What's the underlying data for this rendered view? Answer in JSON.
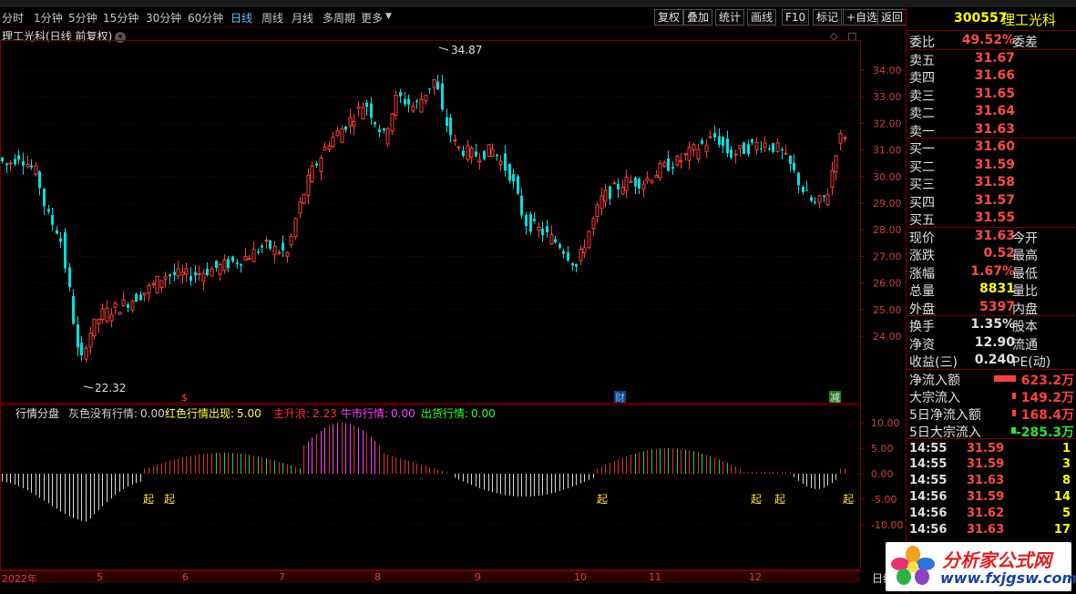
{
  "toolbar": {
    "periods": [
      "分时",
      "1分钟",
      "5分钟",
      "15分钟",
      "30分钟",
      "60分钟",
      "日线",
      "周线",
      "月线",
      "多周期",
      "更多"
    ],
    "active_period": "日线",
    "right_buttons": [
      "复权",
      "叠加",
      "统计",
      "画线",
      "F10",
      "标记",
      "+自选",
      "返回"
    ]
  },
  "chart": {
    "title": "理工光科(日线 前复权)",
    "title_icon": "chevron-down-icon",
    "controls": [
      "◇",
      "□"
    ],
    "price_axis": [
      "34.00",
      "33.00",
      "32.00",
      "31.00",
      "30.00",
      "29.00",
      "28.00",
      "27.00",
      "26.00",
      "25.00",
      "24.00"
    ],
    "high_label": "34.87",
    "low_label": "22.32",
    "markers": [
      "$",
      "财",
      "减"
    ],
    "colors": {
      "up": "#ff3c3c",
      "down": "#00e0e0",
      "grid": "#5a0000"
    }
  },
  "indicator": {
    "name": "行情分盘",
    "items": [
      {
        "label": "灰色没有行情:",
        "value": "0.00",
        "color": "#d0d0d0"
      },
      {
        "label": "红色行情出现:",
        "value": "5.00",
        "color": "#ffff40"
      },
      {
        "label": "主升浪:",
        "value": "2.23",
        "color": "#ff3030"
      },
      {
        "label": "牛市行情:",
        "value": "0.00",
        "color": "#ff40ff"
      },
      {
        "label": "出货行情:",
        "value": "0.00",
        "color": "#30ff30"
      }
    ],
    "axis": [
      "10.00",
      "5.00",
      "0.00",
      "-5.00",
      "-10.00"
    ],
    "signal_text": "起",
    "colors": {
      "gray": "#d8d8d8",
      "red": "#e03030",
      "green": "#30d030",
      "magenta": "#ff40ff"
    }
  },
  "date_axis": [
    "2022年",
    "5",
    "6",
    "7",
    "8",
    "9",
    "10",
    "11",
    "12"
  ],
  "date_axis_right": "日线",
  "quote": {
    "code": "300557",
    "name": "理工光科",
    "wei_bi_label": "委比",
    "wei_bi": "49.52%",
    "wei_cha_label": "委差",
    "asks": [
      {
        "label": "卖五",
        "price": "31.67"
      },
      {
        "label": "卖四",
        "price": "31.66"
      },
      {
        "label": "卖三",
        "price": "31.65"
      },
      {
        "label": "卖二",
        "price": "31.64"
      },
      {
        "label": "卖一",
        "price": "31.63"
      }
    ],
    "bids": [
      {
        "label": "买一",
        "price": "31.60"
      },
      {
        "label": "买二",
        "price": "31.59"
      },
      {
        "label": "买三",
        "price": "31.58"
      },
      {
        "label": "买四",
        "price": "31.57"
      },
      {
        "label": "买五",
        "price": "31.55"
      }
    ],
    "stats": [
      {
        "label": "现价",
        "value": "31.63",
        "label2": "今开",
        "color": "#ff4a4a"
      },
      {
        "label": "涨跌",
        "value": "0.52",
        "label2": "最高",
        "color": "#ff4a4a"
      },
      {
        "label": "涨幅",
        "value": "1.67%",
        "label2": "最低",
        "color": "#ff4a4a"
      },
      {
        "label": "总量",
        "value": "8831",
        "label2": "量比",
        "color": "#ffff00"
      },
      {
        "label": "外盘",
        "value": "5397",
        "label2": "内盘",
        "color": "#ff4a4a"
      }
    ],
    "stats2": [
      {
        "label": "换手",
        "value": "1.35%",
        "label2": "股本",
        "color": "#e0e0e0"
      },
      {
        "label": "净资",
        "value": "12.90",
        "label2": "流通",
        "color": "#e0e0e0"
      },
      {
        "label": "收益(三)",
        "value": "0.240",
        "label2": "PE(动)",
        "color": "#e0e0e0"
      }
    ],
    "flows": [
      {
        "label": "净流入额",
        "value": "623.2万",
        "color": "#ff4040",
        "bar_fraction": 1.0
      },
      {
        "label": "大宗流入",
        "value": "149.2万",
        "color": "#ff4040",
        "bar_fraction": 0.1
      },
      {
        "label": "5日净流入额",
        "value": "168.4万",
        "color": "#ff4040",
        "bar_fraction": 0.1
      },
      {
        "label": "5日大宗流入",
        "value": "-285.3万",
        "color": "#30e030",
        "bar_fraction": 0.2
      }
    ],
    "ticks": [
      {
        "time": "14:55",
        "price": "31.59",
        "vol": "1"
      },
      {
        "time": "14:55",
        "price": "31.59",
        "vol": "3"
      },
      {
        "time": "14:55",
        "price": "31.63",
        "vol": "8"
      },
      {
        "time": "14:56",
        "price": "31.59",
        "vol": "14"
      },
      {
        "time": "14:56",
        "price": "31.62",
        "vol": "5"
      },
      {
        "time": "14:56",
        "price": "31.63",
        "vol": "17"
      }
    ]
  },
  "watermark": {
    "cn": "分析家公式网",
    "url": "www.fxjgsw.com"
  }
}
